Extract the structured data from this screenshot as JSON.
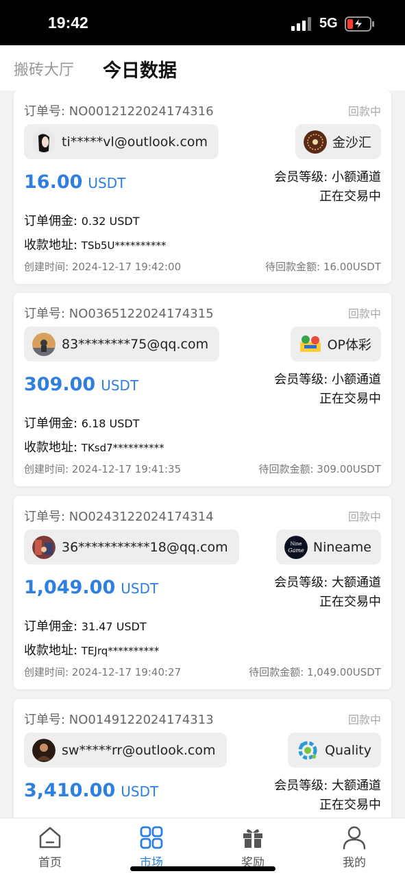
{
  "status_bar": {
    "time": "19:42",
    "network": "5G"
  },
  "header": {
    "tab_inactive": "搬砖大厅",
    "tab_active": "今日数据"
  },
  "orders": [
    {
      "order_no": "订单号: NO0012122024174316",
      "status": "回款中",
      "email": "ti*****vl@outlook.com",
      "brand": "金沙汇",
      "amount": "16.00",
      "unit": "USDT",
      "member_level": "会员等级: 小额通道",
      "trade_status": "正在交易中",
      "commission_label": "订单佣金: ",
      "commission": "0.32 USDT",
      "address_label": "收款地址: ",
      "address": "TSb5U**********",
      "created": "创建时间: 2024-12-17 19:42:00",
      "pending": "待回款金额: 16.00USDT"
    },
    {
      "order_no": "订单号: NO0365122024174315",
      "status": "回款中",
      "email": "83********75@qq.com",
      "brand": "OP体彩",
      "amount": "309.00",
      "unit": "USDT",
      "member_level": "会员等级: 小额通道",
      "trade_status": "正在交易中",
      "commission_label": "订单佣金: ",
      "commission": "6.18 USDT",
      "address_label": "收款地址: ",
      "address": "TKsd7**********",
      "created": "创建时间: 2024-12-17 19:41:35",
      "pending": "待回款金额: 309.00USDT"
    },
    {
      "order_no": "订单号: NO0243122024174314",
      "status": "回款中",
      "email": "36***********18@qq.com",
      "brand": "Nineame",
      "amount": "1,049.00",
      "unit": "USDT",
      "member_level": "会员等级: 大额通道",
      "trade_status": "正在交易中",
      "commission_label": "订单佣金: ",
      "commission": "31.47 USDT",
      "address_label": "收款地址: ",
      "address": "TEJrq**********",
      "created": "创建时间: 2024-12-17 19:40:27",
      "pending": "待回款金额: 1,049.00USDT"
    },
    {
      "order_no": "订单号: NO0149122024174313",
      "status": "回款中",
      "email": "sw*****rr@outlook.com",
      "brand": "Quality",
      "amount": "3,410.00",
      "unit": "USDT",
      "member_level": "会员等级: 大额通道",
      "trade_status": "正在交易中"
    }
  ],
  "nav": [
    {
      "label": "首页",
      "icon": "home-icon"
    },
    {
      "label": "市场",
      "icon": "grid-icon",
      "active": true
    },
    {
      "label": "奖励",
      "icon": "gift-icon"
    },
    {
      "label": "我的",
      "icon": "user-icon"
    }
  ],
  "colors": {
    "accent": "#2f7fe0",
    "muted": "#aaaaaa",
    "pill_bg": "#eeeeef"
  }
}
